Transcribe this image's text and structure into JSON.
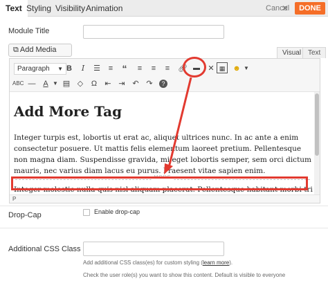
{
  "tabs": [
    "Text",
    "Styling",
    "Visibility",
    "Animation"
  ],
  "actions": {
    "cancel_label": "Cancel",
    "close_glyph": "✕",
    "done_label": "DONE"
  },
  "fields": {
    "module_title_label": "Module Title",
    "add_media_label": "Add Media",
    "visual_tab": "Visual",
    "text_tab": "Text"
  },
  "toolbar": {
    "format_value": "Paragraph",
    "icons": [
      "bold-icon",
      "italic-icon",
      "bullet-list-icon",
      "numbered-list-icon",
      "blockquote-icon",
      "align-left-icon",
      "align-center-icon",
      "align-right-icon",
      "link-icon",
      "read-more-icon",
      "fullscreen-icon",
      "toolbar-toggle-icon",
      "emoji-icon"
    ],
    "row2_icons": [
      "strikethrough-icon",
      "horizontal-line-icon",
      "text-color-icon",
      "paste-text-icon",
      "clear-formatting-icon",
      "special-character-icon",
      "outdent-icon",
      "indent-icon",
      "undo-icon",
      "redo-icon",
      "help-icon"
    ]
  },
  "content": {
    "heading": "Add More Tag",
    "paragraph1": "Integer turpis est, lobortis ut erat ac, aliquet ultrices nunc. In ac ante a enim consectetur posuere. Ut mattis felis elementum laoreet pretium. Pellentesque non magna diam. Suspendisse gravida, mi eget lobortis semper, sem orci dictum mauris, nec varius diam lacus eu purus. Praesent vitae sapien enim.",
    "more_label": "MORE",
    "paragraph2": "Integer molestie nulla quis nisl aliquam placerat. Pellentesque habitant morbi tristique",
    "path": "P"
  },
  "dropcap": {
    "label": "Drop-Cap",
    "checkbox_label": "Enable drop-cap"
  },
  "css_class": {
    "label": "Additional CSS Class",
    "help_prefix": "Add additional CSS class(es) for custom styling (",
    "help_link": "learn more",
    "help_suffix": ").",
    "help2": "Check the user role(s) you want to show this content. Default is visible to everyone"
  },
  "colors": {
    "accent": "#f56e28",
    "highlight": "#e23a30"
  }
}
